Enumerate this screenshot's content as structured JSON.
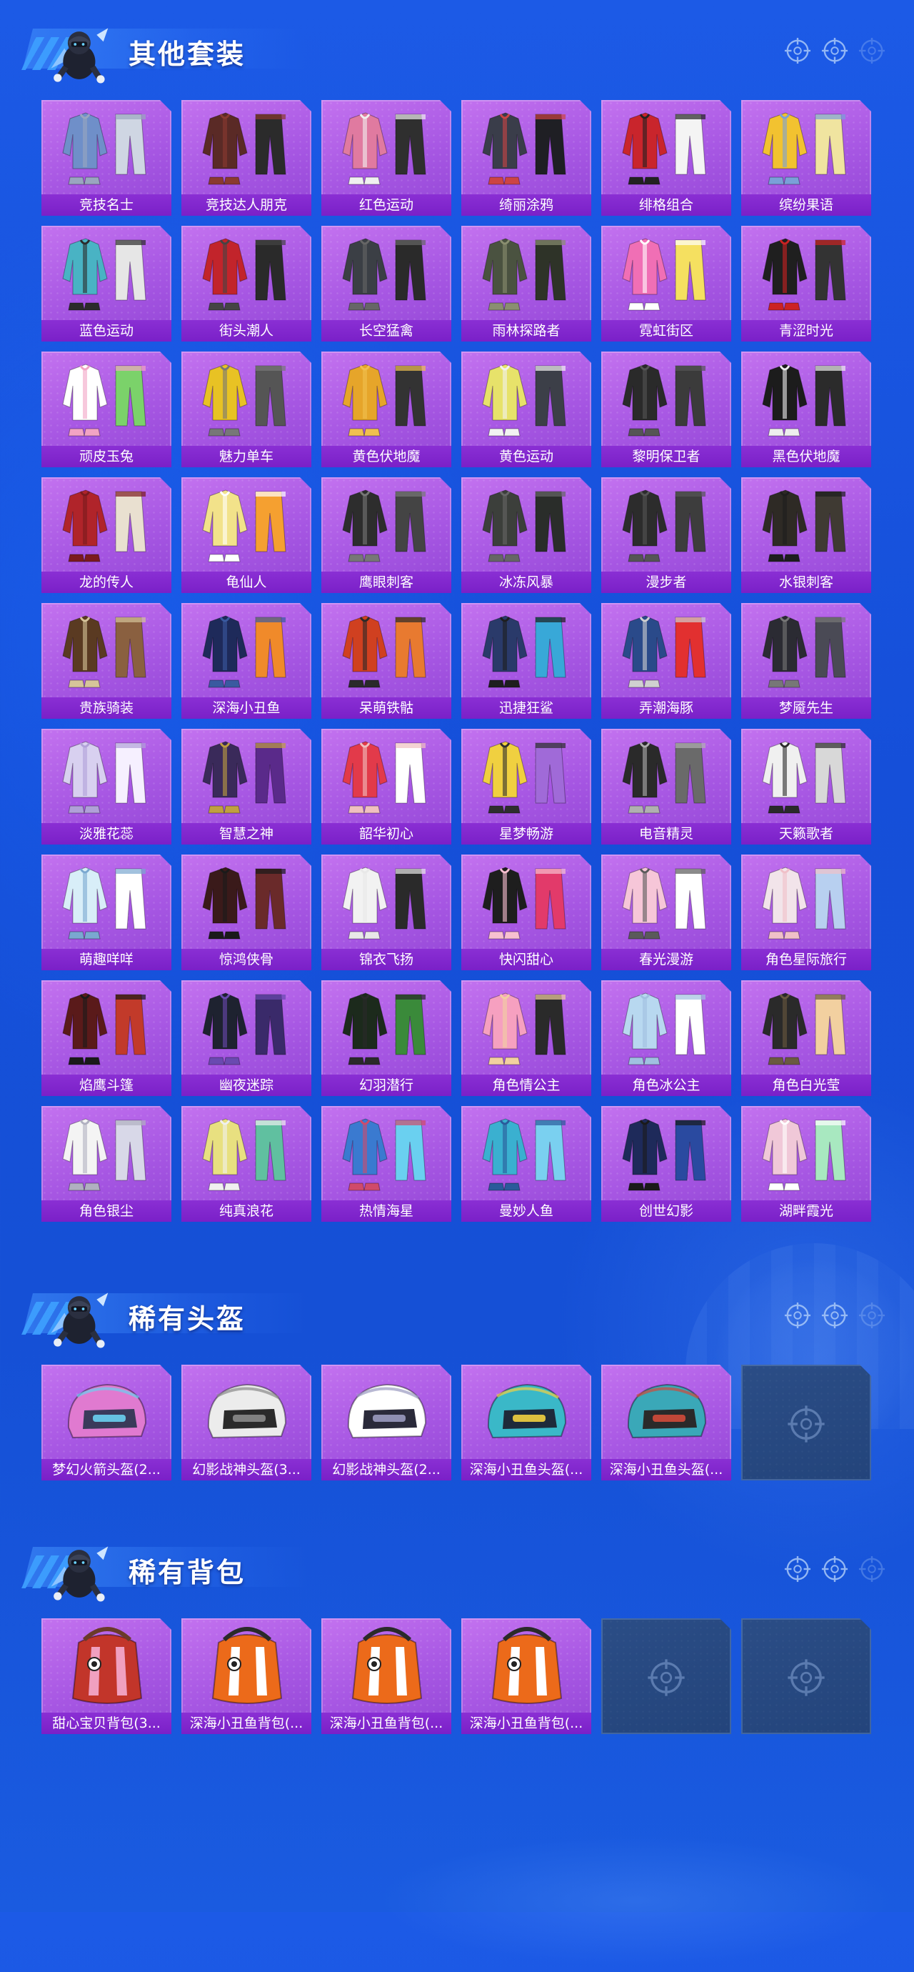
{
  "sections": [
    {
      "title": "其他套装",
      "items": [
        "竞技名士",
        "竞技达人朋克",
        "红色运动",
        "绮丽涂鸦",
        "绯格组合",
        "缤纷果语",
        "蓝色运动",
        "街头潮人",
        "长空猛禽",
        "雨林探路者",
        "霓虹街区",
        "青涩时光",
        "顽皮玉兔",
        "魅力单车",
        "黄色伏地魔",
        "黄色运动",
        "黎明保卫者",
        "黑色伏地魔",
        "龙的传人",
        "龟仙人",
        "鹰眼刺客",
        "冰冻风暴",
        "漫步者",
        "水银刺客",
        "贵族骑装",
        "深海小丑鱼",
        "呆萌铁骷",
        "迅捷狂鲨",
        "弄潮海豚",
        "梦魇先生",
        "淡雅花蕊",
        "智慧之神",
        "韶华初心",
        "星梦畅游",
        "电音精灵",
        "天籁歌者",
        "萌趣咩咩",
        "惊鸿侠骨",
        "锦衣飞扬",
        "快闪甜心",
        "春光漫游",
        "角色星际旅行",
        "焰鹰斗篷",
        "幽夜迷踪",
        "幻羽潜行",
        "角色情公主",
        "角色冰公主",
        "角色白光莹",
        "角色银尘",
        "纯真浪花",
        "热情海星",
        "曼妙人鱼",
        "创世幻影",
        "湖畔霞光"
      ],
      "empty_slots": 0
    },
    {
      "title": "稀有头盔",
      "items": [
        "梦幻火箭头盔(2...",
        "幻影战神头盔(3...",
        "幻影战神头盔(2...",
        "深海小丑鱼头盔(...",
        "深海小丑鱼头盔(..."
      ],
      "empty_slots": 1
    },
    {
      "title": "稀有背包",
      "items": [
        "甜心宝贝背包(3...",
        "深海小丑鱼背包(...",
        "深海小丑鱼背包(...",
        "深海小丑鱼背包(..."
      ],
      "empty_slots": 2
    }
  ],
  "colors": {
    "background": "#1a56e0",
    "card": "#a757e3",
    "card_label": "#7a20c8",
    "empty_card": "#264780"
  },
  "icons": {
    "header_decor": "crosshair-icon",
    "empty_slot": "crosshair-icon",
    "section_mascot": "mascot-icon"
  }
}
